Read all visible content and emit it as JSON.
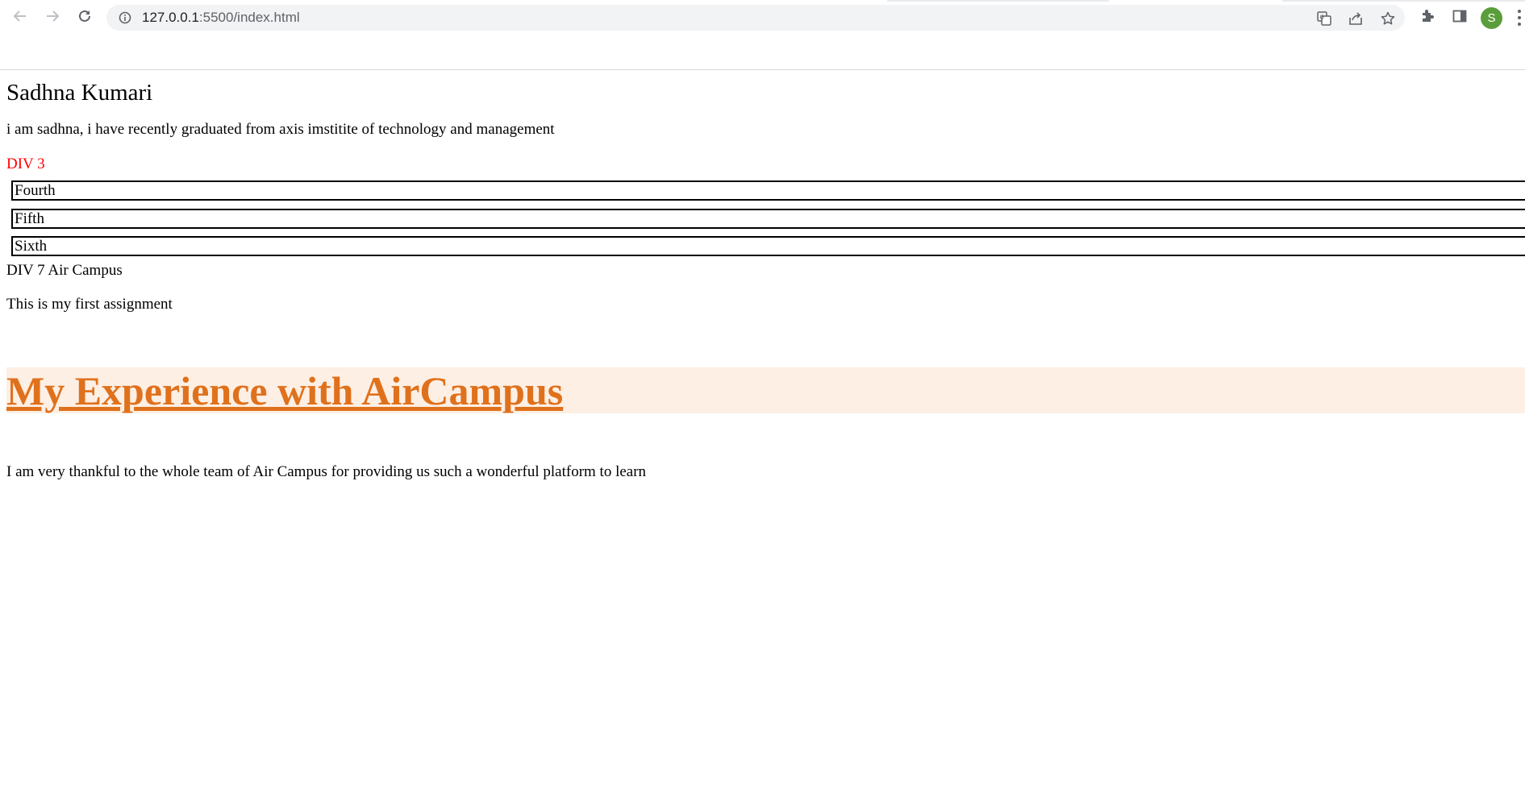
{
  "browser": {
    "url_host": "127.0.0.1",
    "url_rest": ":5500/index.html",
    "profile_initial": "S",
    "profile_color": "#5a9e3b"
  },
  "page": {
    "title": "Sadhna Kumari",
    "intro": "i am sadhna, i have recently graduated from axis imstitite of technology and management",
    "div3_label": "DIV 3",
    "boxes": [
      "Fourth",
      "Fifth",
      "Sixth"
    ],
    "div7": "DIV 7 Air Campus",
    "assignment": "This is my first assignment",
    "experience_heading": "My Experience with AirCampus",
    "thanks": "I am very thankful to the whole team of Air Campus for providing us such a wonderful platform to learn"
  },
  "colors": {
    "div3_text": "#ff0000",
    "heading_text": "#e0711c",
    "heading_background": "#fdefe4"
  }
}
